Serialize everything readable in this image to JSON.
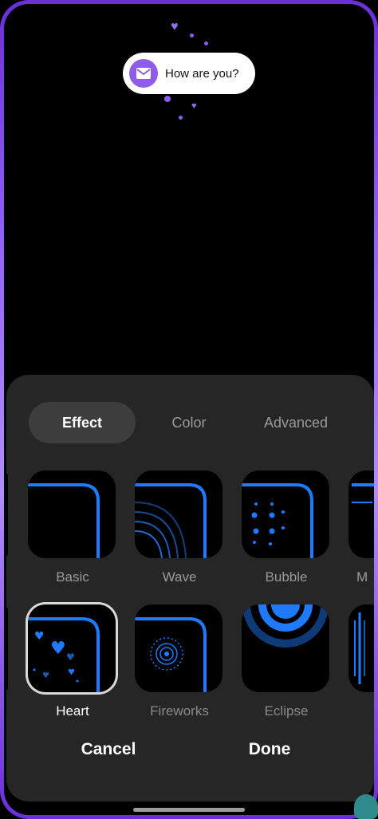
{
  "notification": {
    "text": "How are you?",
    "icon": "mail-icon"
  },
  "tabs": [
    {
      "label": "Effect",
      "active": true
    },
    {
      "label": "Color",
      "active": false
    },
    {
      "label": "Advanced",
      "active": false
    }
  ],
  "effects": [
    {
      "label": "Basic",
      "selected": false
    },
    {
      "label": "Wave",
      "selected": false
    },
    {
      "label": "Bubble",
      "selected": false
    },
    {
      "label": "M",
      "selected": false
    },
    {
      "label": "Heart",
      "selected": true
    },
    {
      "label": "Fireworks",
      "selected": false
    },
    {
      "label": "Eclipse",
      "selected": false
    }
  ],
  "actions": {
    "cancel": "Cancel",
    "done": "Done"
  },
  "colors": {
    "accent": "#1e7bff",
    "edge": "#9a6bff",
    "sheet": "#262626"
  }
}
